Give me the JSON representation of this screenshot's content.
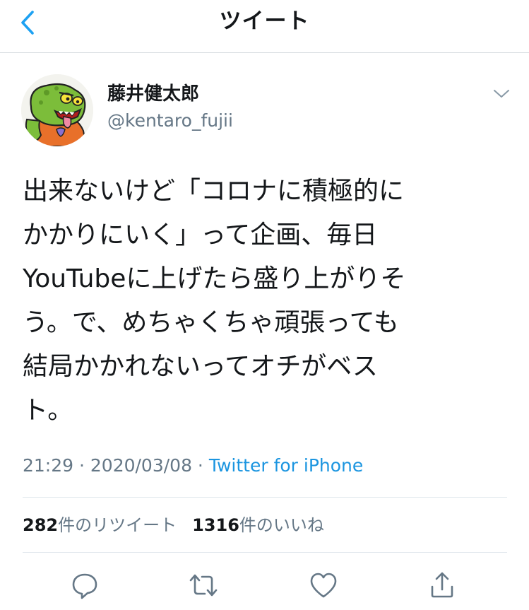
{
  "nav": {
    "title": "ツイート",
    "back_icon": "chevron-left-icon",
    "accent": "#1da1f2"
  },
  "user": {
    "name": "藤井健太郎",
    "handle": "@kentaro_fujii",
    "avatar": "green-monster-avatar"
  },
  "tweet": {
    "text": "出来ないけど「コロナに積極的に\nかかりにいく」って企画、毎日\nYouTubeに上げたら盛り上がりそ\nう。で、めちゃくちゃ頑張っても\n結局かかれないってオチがベス\nト。"
  },
  "meta": {
    "time": "21:29",
    "separator": " · ",
    "date": "2020/03/08",
    "source": "Twitter for iPhone"
  },
  "stats": {
    "retweets_count": "282",
    "retweets_label": "件のリツイート",
    "likes_count": "1316",
    "likes_label": "件のいいね"
  },
  "actions": [
    {
      "name": "reply-icon"
    },
    {
      "name": "retweet-icon"
    },
    {
      "name": "like-icon"
    },
    {
      "name": "share-icon"
    }
  ],
  "colors": {
    "text": "#14171a",
    "secondary": "#657786",
    "link": "#1b95e0",
    "divider": "#e1e8ed"
  }
}
